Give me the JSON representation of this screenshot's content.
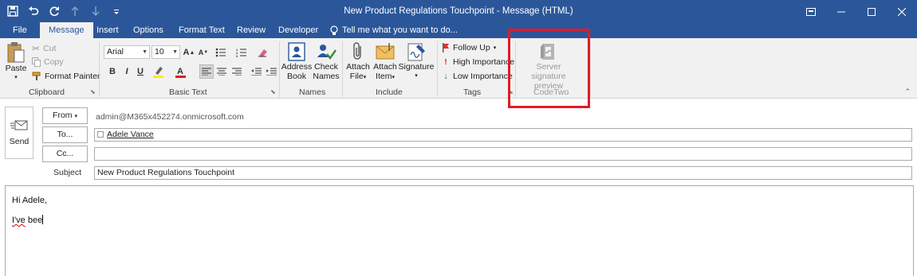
{
  "window": {
    "title": "New Product Regulations Touchpoint - Message (HTML)"
  },
  "quick_access": [
    "save-icon",
    "undo-icon",
    "redo-icon",
    "up-arrow-icon",
    "down-arrow-icon",
    "customize-icon"
  ],
  "tabs": [
    {
      "label": "File"
    },
    {
      "label": "Message"
    },
    {
      "label": "Insert"
    },
    {
      "label": "Options"
    },
    {
      "label": "Format Text"
    },
    {
      "label": "Review"
    },
    {
      "label": "Developer"
    }
  ],
  "tell_me": "Tell me what you want to do...",
  "ribbon": {
    "clipboard": {
      "paste": "Paste",
      "cut": "Cut",
      "copy": "Copy",
      "format_painter": "Format Painter",
      "label": "Clipboard"
    },
    "basic_text": {
      "font": "Arial",
      "size": "10",
      "bold": "B",
      "italic": "I",
      "underline": "U",
      "label": "Basic Text"
    },
    "names": {
      "address_book_1": "Address",
      "address_book_2": "Book",
      "check_names_1": "Check",
      "check_names_2": "Names",
      "label": "Names"
    },
    "include": {
      "attach_file_1": "Attach",
      "attach_file_2": "File",
      "attach_item_1": "Attach",
      "attach_item_2": "Item",
      "signature": "Signature",
      "label": "Include"
    },
    "tags": {
      "follow_up": "Follow Up",
      "high_importance": "High Importance",
      "low_importance": "Low Importance",
      "label": "Tags"
    },
    "codetwo": {
      "server_sig_1": "Server signature",
      "server_sig_2": "preview",
      "label": "CodeTwo"
    }
  },
  "compose": {
    "send": "Send",
    "from_button": "From",
    "from_value": "admin@M365x452274.onmicrosoft.com",
    "to_button": "To...",
    "to_value": "Adele Vance",
    "cc_button": "Cc...",
    "cc_value": "",
    "subject_label": "Subject",
    "subject_value": "New Product Regulations Touchpoint"
  },
  "body": {
    "line1": "Hi Adele,",
    "line2_misspelled": "I've",
    "line2_rest": " bee"
  },
  "colors": {
    "title_bar": "#2b579a",
    "ribbon": "#f1f1f1",
    "highlight": "#e01b24"
  }
}
